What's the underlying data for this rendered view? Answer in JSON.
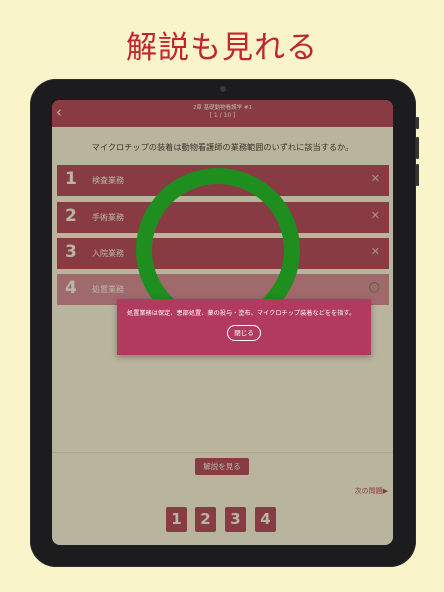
{
  "headline": "解説も見れる",
  "app": {
    "header": {
      "title": "2章 基礎動物看護学 #1",
      "counter": "[ 1 / 10 ]"
    },
    "question": "マイクロチップの装着は動物看護師の業務範囲のいずれに該当するか。",
    "answers": [
      {
        "num": "1",
        "label": "検査業務",
        "mark": "✕"
      },
      {
        "num": "2",
        "label": "手術業務",
        "mark": "✕"
      },
      {
        "num": "3",
        "label": "入院業務",
        "mark": "✕"
      },
      {
        "num": "4",
        "label": "処置業務",
        "mark": "◯"
      }
    ],
    "explain_button": "解説を見る",
    "next_link": "次の問題",
    "number_buttons": [
      "1",
      "2",
      "3",
      "4"
    ],
    "popup": {
      "text": "処置業務は保定、患部処置、薬の投与・塗布、マイクロチップ装着などをを指す。",
      "close_label": "閉じる"
    }
  },
  "icons": {
    "back": "chevron-left-icon",
    "next": "triangle-right-icon"
  },
  "colors": {
    "brand": "#b23a5f",
    "correct_ring": "#1e8e1e",
    "headline": "#c0262c",
    "background": "#f9f4c9"
  }
}
